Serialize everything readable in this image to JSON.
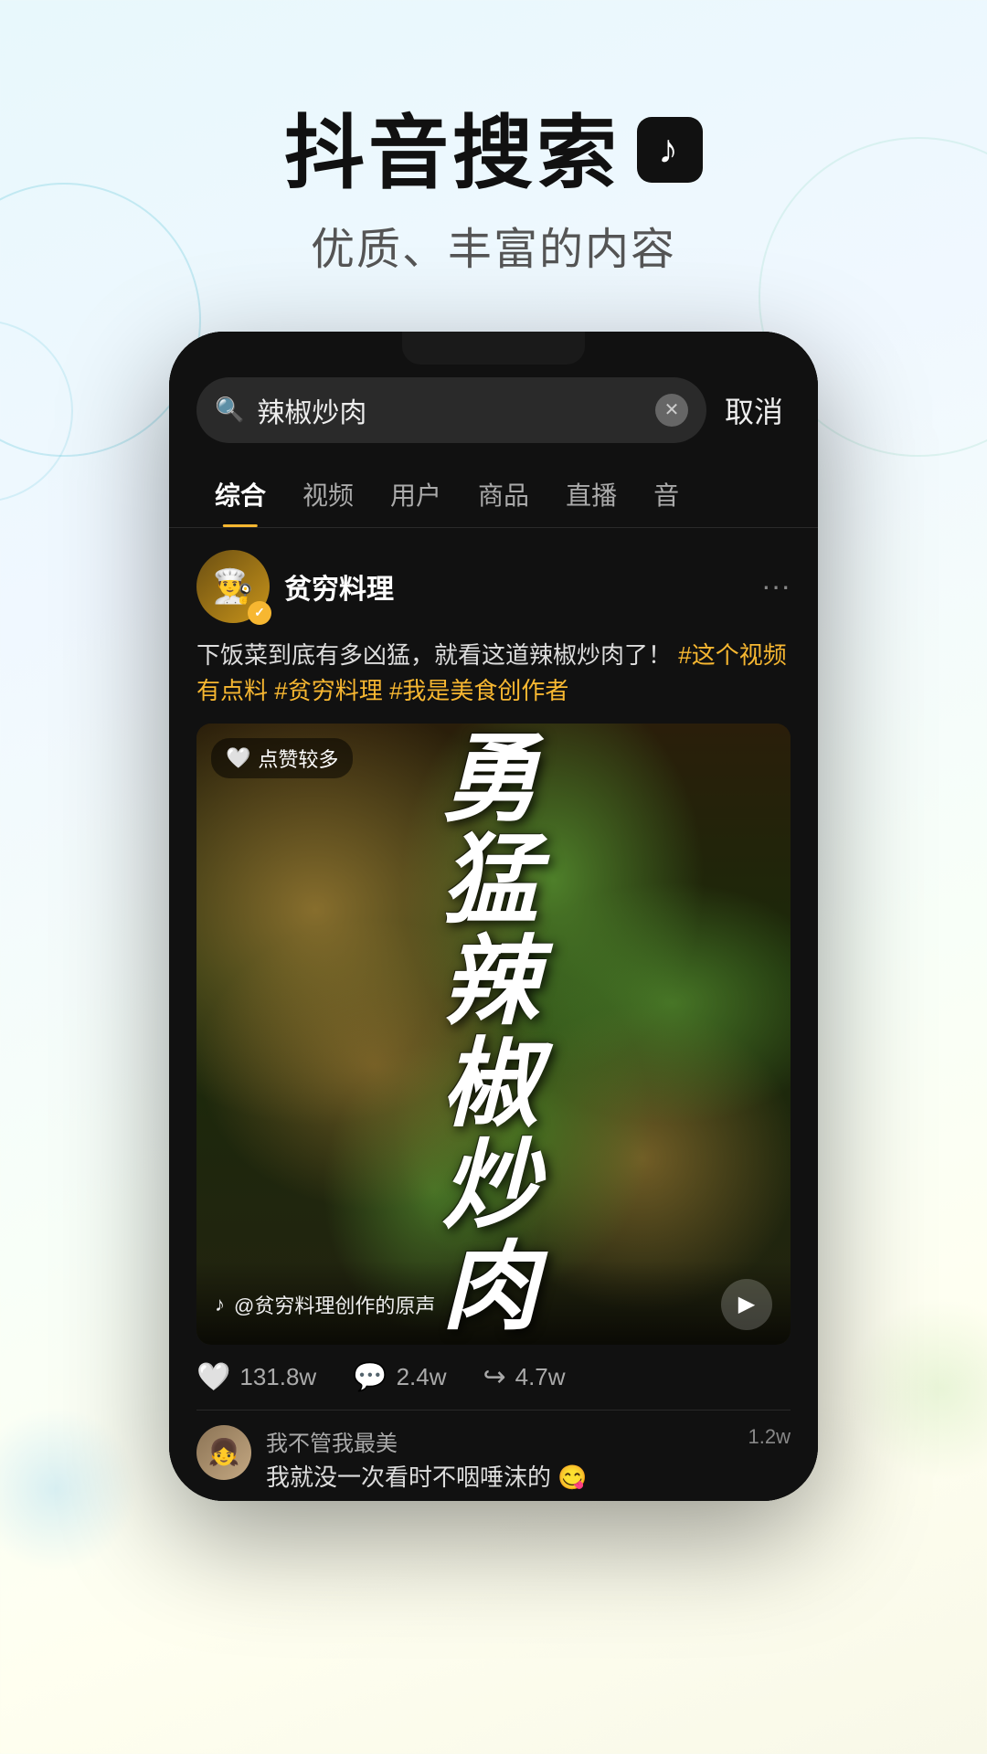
{
  "header": {
    "title": "抖音搜索",
    "logo_symbol": "♪",
    "subtitle": "优质、丰富的内容"
  },
  "phone": {
    "search_bar": {
      "query": "辣椒炒肉",
      "cancel_label": "取消",
      "placeholder": "搜索"
    },
    "tabs": [
      {
        "label": "综合",
        "active": true
      },
      {
        "label": "视频",
        "active": false
      },
      {
        "label": "用户",
        "active": false
      },
      {
        "label": "商品",
        "active": false
      },
      {
        "label": "直播",
        "active": false
      },
      {
        "label": "音",
        "active": false
      }
    ],
    "post": {
      "user_name": "贫穷料理",
      "post_text": "下饭菜到底有多凶猛，就看这道辣椒炒肉了！",
      "hashtags": [
        "#这个视频有点料",
        "#贫穷料理",
        "#我是美食创作者"
      ],
      "video_text": "勇\n猛\n辣\n椒\n炒\n肉",
      "video_text_big": "勇猛\n辣椒\n炒肉",
      "likes_badge": "点赞较多",
      "video_source": "@贫穷料理创作的原声",
      "engagement": {
        "likes": "131.8w",
        "comments": "2.4w",
        "shares": "4.7w"
      },
      "comment_user": "我不管我最美",
      "comment_text": "我就没一次看时不咽唾沫的 😋",
      "comment_count": "1.2w"
    }
  }
}
